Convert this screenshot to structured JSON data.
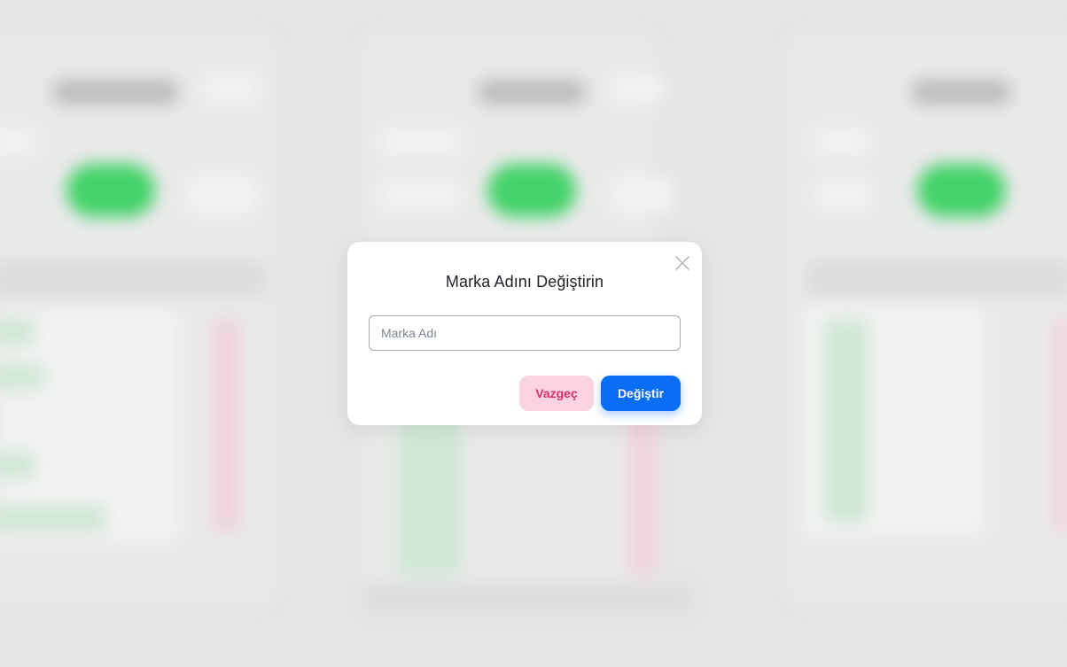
{
  "dialog": {
    "title": "Marka Adını Değiştirin",
    "input_placeholder": "Marka Adı",
    "input_value": "",
    "cancel_label": "Vazgeç",
    "submit_label": "Değiştir",
    "close_icon": "close-icon"
  },
  "colors": {
    "primary": "#0a6ef5",
    "cancel_bg": "#fbd3e0",
    "cancel_text": "#dc2d6b",
    "backdrop": "#e5e5e5"
  }
}
